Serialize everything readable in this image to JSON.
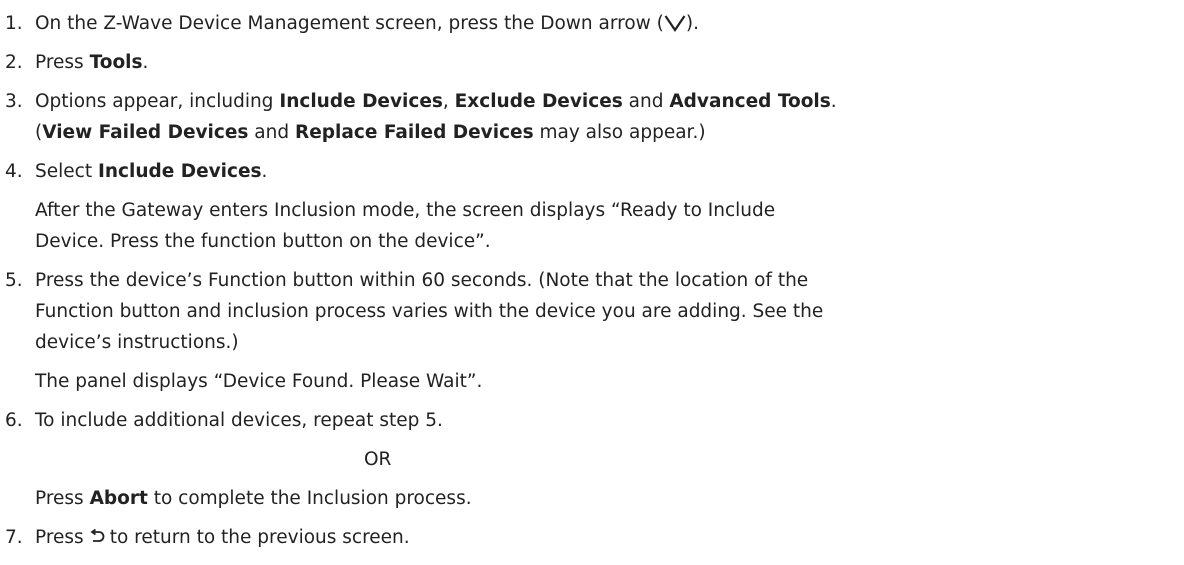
{
  "steps": [
    {
      "num": "1.",
      "t1": "On the Z-Wave Device Management screen, press the Down arrow (",
      "icon": "chevron-down-icon",
      "t2": ")."
    },
    {
      "num": "2.",
      "t1": "Press ",
      "b1": "Tools",
      "t2": "."
    },
    {
      "num": "3.",
      "t1": "Options appear, including ",
      "b1": "Include Devices",
      "t2": ", ",
      "b2": "Exclude Devices",
      "t3": " and ",
      "b3": "Advanced Tools",
      "t4": ".",
      "l2_t1": "(",
      "l2_b1": "View Failed Devices",
      "l2_t2": " and ",
      "l2_b2": "Replace Failed Devices",
      "l2_t3": " may also appear.)"
    },
    {
      "num": "4.",
      "t1": "Select ",
      "b1": "Include Devices",
      "t2": ".",
      "sub1": "After the Gateway enters Inclusion mode, the screen displays “Ready to Include",
      "sub2": "Device. Press the function button on the device”."
    },
    {
      "num": "5.",
      "l1": "Press the device’s Function button within 60 seconds. (Note that the location of the",
      "l2": "Function button and inclusion process varies with the device you are adding. See the",
      "l3": "device’s instructions.)",
      "sub1": "The panel displays “Device Found. Please Wait”."
    },
    {
      "num": "6.",
      "t1": "To include additional devices, repeat step 5.",
      "or": "OR",
      "sub_t1": "Press ",
      "sub_b1": "Abort",
      "sub_t2": " to complete the Inclusion process."
    },
    {
      "num": "7.",
      "t1": "Press",
      "icon": "back-arrow-icon",
      "t2": "to return to the previous screen."
    }
  ]
}
